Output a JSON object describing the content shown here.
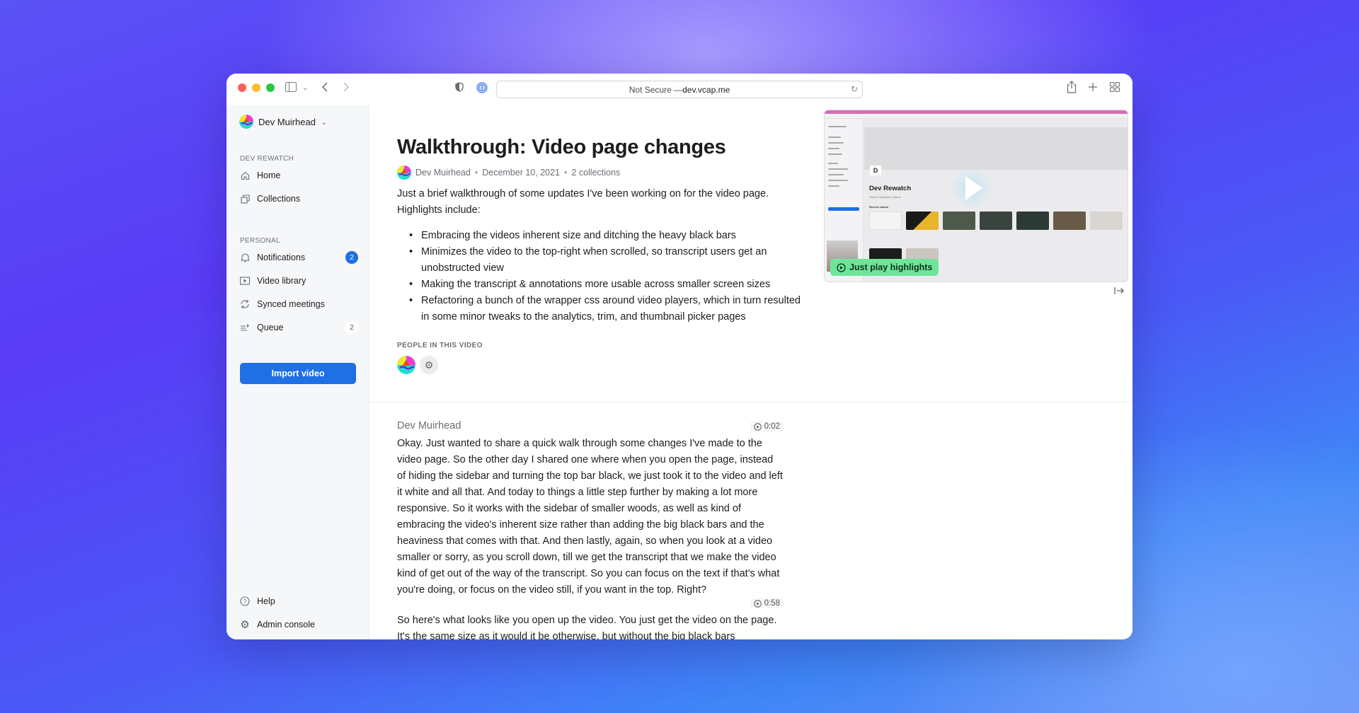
{
  "browser": {
    "url_prefix": "Not Secure — ",
    "url_host": "dev.vcap.me",
    "icons": {
      "sidebar_toggle": "sidebar-icon",
      "back": "chevron-left-icon",
      "forward": "chevron-right-icon",
      "privacy": "shield-icon",
      "password": "password-manager-icon",
      "reload": "reload-icon",
      "share": "share-icon",
      "new_tab": "plus-icon",
      "tab_overview": "grid-icon"
    }
  },
  "sidebar": {
    "user_name": "Dev Muirhead",
    "workspace_label": "DEV REWATCH",
    "workspace_items": [
      {
        "label": "Home",
        "icon": "home-icon"
      },
      {
        "label": "Collections",
        "icon": "collections-icon"
      }
    ],
    "personal_label": "PERSONAL",
    "personal_items": [
      {
        "label": "Notifications",
        "icon": "bell-icon",
        "badge": "2"
      },
      {
        "label": "Video library",
        "icon": "video-library-icon"
      },
      {
        "label": "Synced meetings",
        "icon": "sync-icon"
      },
      {
        "label": "Queue",
        "icon": "queue-icon",
        "badge": "2"
      }
    ],
    "import_button": "Import video",
    "footer_items": [
      {
        "label": "Help",
        "icon": "help-icon"
      },
      {
        "label": "Admin console",
        "icon": "gear-icon"
      }
    ]
  },
  "video_page": {
    "title": "Walkthrough: Video page changes",
    "author": "Dev Muirhead",
    "date": "December 10, 2021",
    "collections": "2 collections",
    "separator": "•",
    "description": "Just a brief walkthrough of some updates I've been working on for the video page. Highlights include:",
    "highlights": [
      "Embracing the videos inherent size and ditching the heavy black bars",
      "Minimizes the video to the top-right when scrolled, so transcript users get an unobstructed view",
      "Making the transcript & annotations more usable across smaller screen sizes",
      "Refactoring a bunch of the wrapper css around video players, which in turn resulted in some minor tweaks to the analytics, trim, and thumbnail picker pages"
    ],
    "people_label": "PEOPLE IN THIS VIDEO"
  },
  "player": {
    "highlights_button": "Just play highlights",
    "preview_title": "Dev Rewatch",
    "preview_tabs": "Home   Collections   Videos",
    "preview_recent": "Recent videos",
    "preview_avatar_letter": "D"
  },
  "transcript": {
    "speaker": "Dev Muirhead",
    "segments": [
      {
        "time": "0:02",
        "text": "Okay. Just wanted to share a quick walk through some changes I've made to the video page. So the other day I shared one where when you open the page, instead of hiding the sidebar and turning the top bar black, we just took it to the video and left it white and all that. And today to things a little step further by making a lot more responsive. So it works with the sidebar of smaller woods, as well as kind of embracing the video's inherent size rather than adding the big black bars and the heaviness that comes with that. And then lastly, again, so when you look at a video smaller or sorry, as you scroll down, till we get the transcript that we make the video kind of get out of the way of the transcript. So you can focus on the text if that's what you're doing, or focus on the video still, if you want in the top. Right?"
      },
      {
        "time": "0:58",
        "text": "So here's what looks like you open up the video. You just get the video on the page. It's the same size as it would it be otherwise, but without the big black bars"
      }
    ]
  },
  "colors": {
    "accent": "#1f6fe5",
    "highlight_green": "#6ee69a"
  }
}
